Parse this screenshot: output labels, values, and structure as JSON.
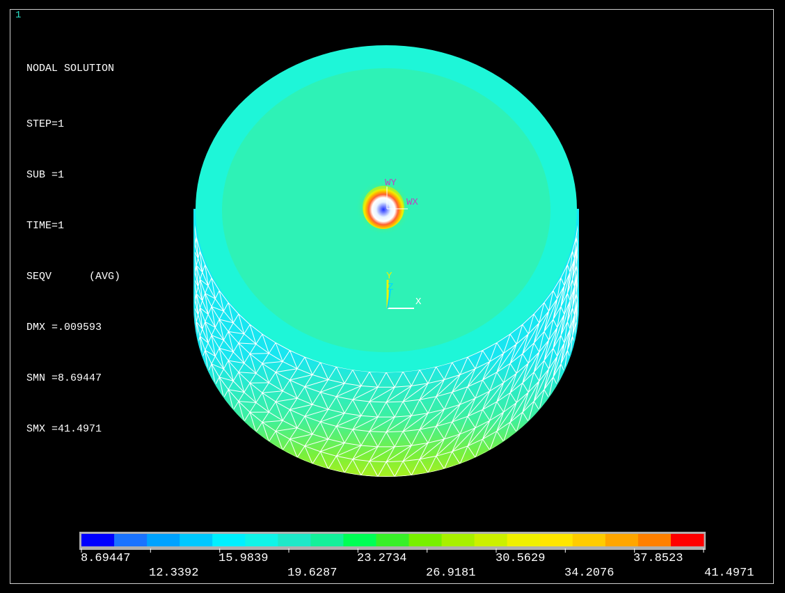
{
  "window_number": "1",
  "info": {
    "title": "NODAL SOLUTION",
    "lines": [
      "STEP=1",
      "SUB =1",
      "TIME=1",
      "SEQV      (AVG)",
      "DMX =.009593",
      "SMN =8.69447",
      "SMX =41.4971"
    ]
  },
  "triads": {
    "working_plane": {
      "x_label": "WX",
      "y_label": "WY"
    },
    "global": {
      "x_label": "X",
      "y_label": "Y",
      "z_label": "Z"
    }
  },
  "colors": {
    "background": "#000000",
    "top_face": "#2ef2b6",
    "rim": "#1ef6d8",
    "side_upper": "#12e8f4",
    "side_lower": "#58f04a",
    "mesh_line": "#ffffff",
    "frame": "#cfcfcf",
    "window_number": "#29e3c9"
  },
  "legend": {
    "colors": [
      "#0000ff",
      "#1a73ff",
      "#00a2ff",
      "#00c8ff",
      "#00f0ff",
      "#10f4e8",
      "#1ee8c8",
      "#14f09a",
      "#00ff55",
      "#38f028",
      "#78f000",
      "#a8f000",
      "#ccf000",
      "#f0f000",
      "#ffe600",
      "#ffcc00",
      "#ffa600",
      "#ff8000",
      "#ff0000"
    ],
    "top_labels": [
      "8.69447",
      "15.9839",
      "23.2734",
      "30.5629",
      "37.8523"
    ],
    "bottom_labels": [
      "12.3392",
      "19.6287",
      "26.9181",
      "34.2076",
      "41.4971"
    ]
  }
}
